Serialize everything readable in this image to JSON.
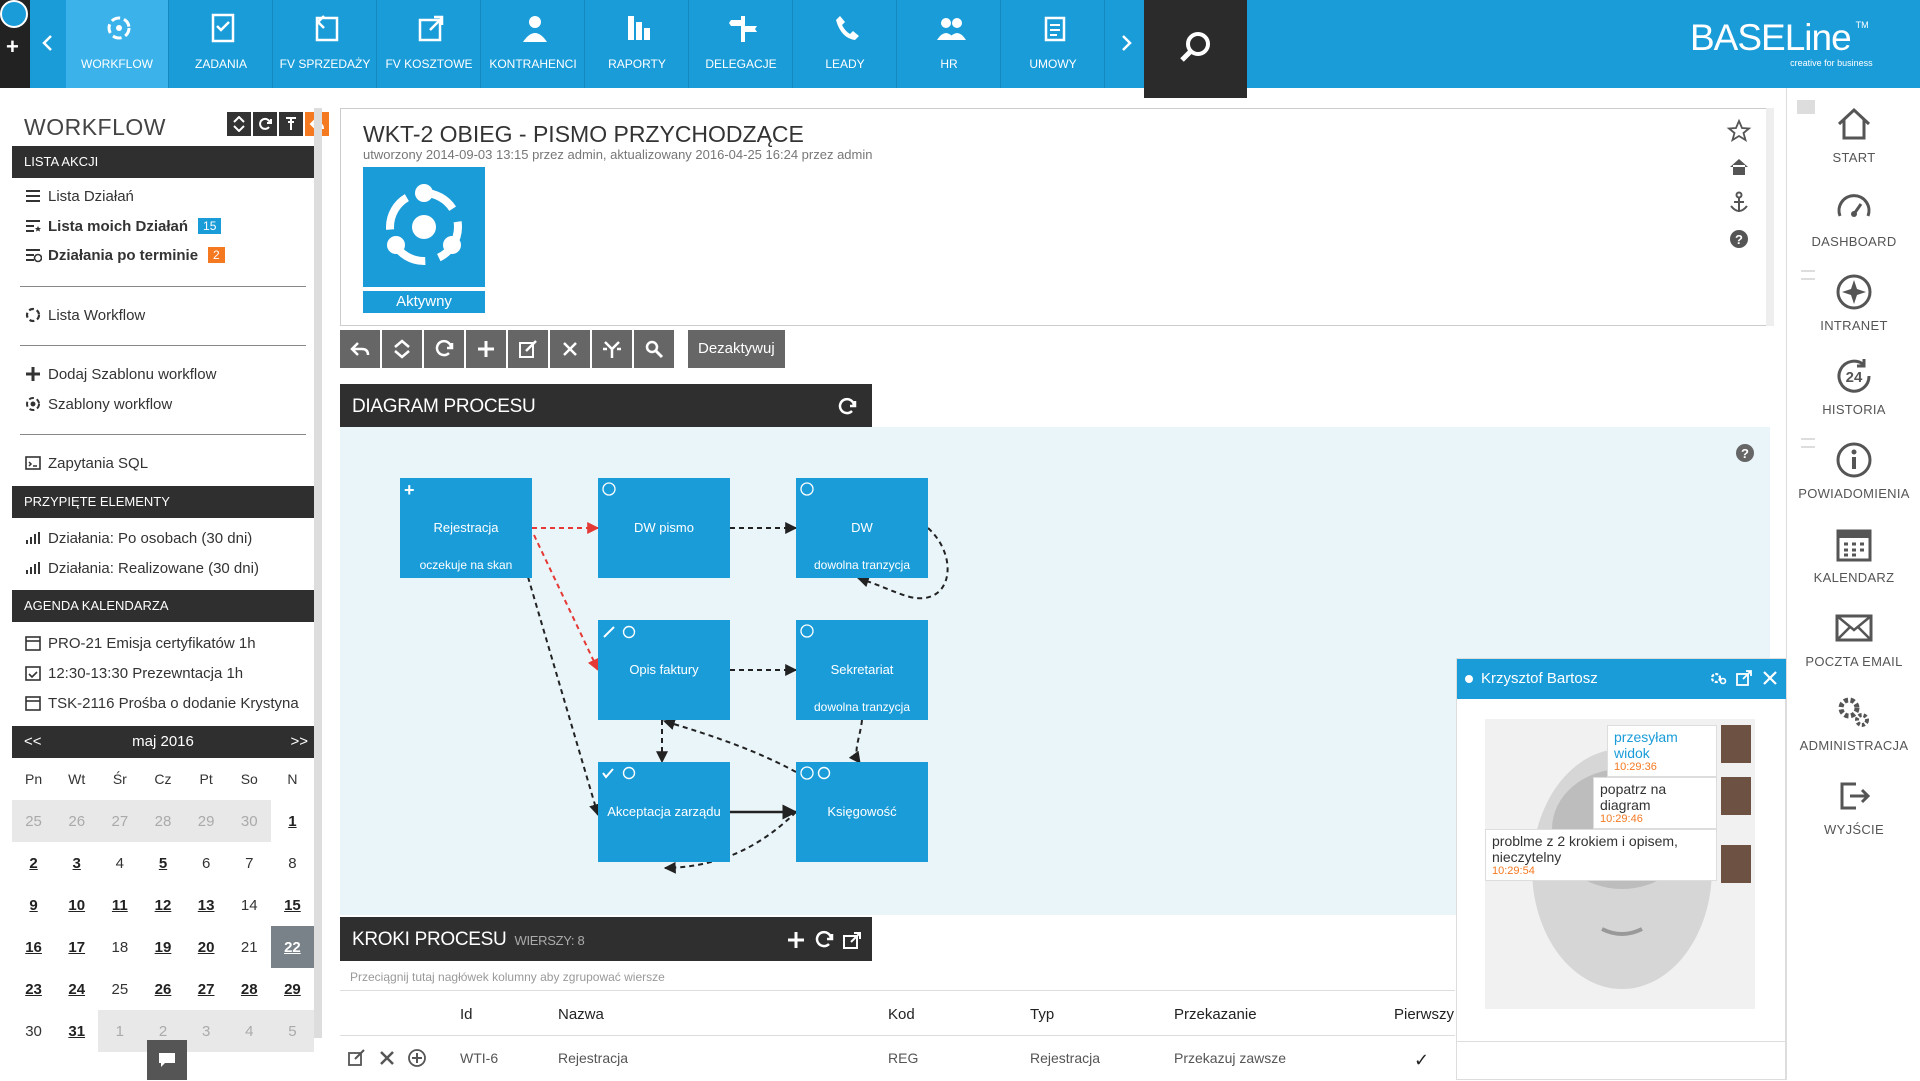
{
  "topbar": {
    "modules": [
      {
        "label": "WORKFLOW",
        "icon": "workflow-icon",
        "active": true
      },
      {
        "label": "ZADANIA",
        "icon": "tasks-icon"
      },
      {
        "label": "FV SPRZEDAŻY",
        "icon": "sales-invoice-icon"
      },
      {
        "label": "FV KOSZTOWE",
        "icon": "cost-invoice-icon"
      },
      {
        "label": "KONTRAHENCI",
        "icon": "contractors-icon"
      },
      {
        "label": "RAPORTY",
        "icon": "reports-icon"
      },
      {
        "label": "DELEGACJE",
        "icon": "signpost-icon"
      },
      {
        "label": "LEADY",
        "icon": "phone-icon"
      },
      {
        "label": "HR",
        "icon": "people-icon"
      },
      {
        "label": "UMOWY",
        "icon": "document-icon"
      }
    ],
    "brand": {
      "name": "BASELine",
      "tm": "TM",
      "tagline": "creative for business"
    }
  },
  "sidebar": {
    "title": "WORKFLOW",
    "section_actions": "LISTA AKCJI",
    "actions": [
      {
        "label": "Lista Działań"
      },
      {
        "label": "Lista moich Działań",
        "badge": "15"
      },
      {
        "label": "Działania po terminie",
        "badge": "2"
      },
      {
        "label": "Lista Workflow"
      },
      {
        "label": "Dodaj Szablonu workflow"
      },
      {
        "label": "Szablony workflow"
      },
      {
        "label": "Zapytania SQL"
      }
    ],
    "section_pinned": "PRZYPIĘTE ELEMENTY",
    "pinned": [
      {
        "label": "Działania: Po osobach (30 dni)"
      },
      {
        "label": "Działania: Realizowane (30 dni)"
      }
    ],
    "section_agenda": "AGENDA KALENDARZA",
    "agenda": [
      {
        "label": "PRO-21 Emisja certyfikatów 1h"
      },
      {
        "label": "12:30-13:30 Prezewntacja 1h"
      },
      {
        "label": "TSK-2116 Prośba o dodanie Krystyna"
      }
    ],
    "calendar": {
      "prev": "<<",
      "next": ">>",
      "month": "maj 2016",
      "days_of_week": [
        "Pn",
        "Wt",
        "Śr",
        "Cz",
        "Pt",
        "So",
        "N"
      ],
      "weeks": [
        [
          "25",
          "26",
          "27",
          "28",
          "29",
          "30",
          "1"
        ],
        [
          "2",
          "3",
          "4",
          "5",
          "6",
          "7",
          "8"
        ],
        [
          "9",
          "10",
          "11",
          "12",
          "13",
          "14",
          "15"
        ],
        [
          "16",
          "17",
          "18",
          "19",
          "20",
          "21",
          "22"
        ],
        [
          "23",
          "24",
          "25",
          "26",
          "27",
          "28",
          "29"
        ],
        [
          "30",
          "31",
          "1",
          "2",
          "3",
          "4",
          "5"
        ]
      ],
      "today": "22"
    }
  },
  "workflow": {
    "title": "WKT-2  OBIEG - PISMO PRZYCHODZĄCE",
    "meta": "utworzony 2014-09-03 13:15 przez admin, aktualizowany 2016-04-25 16:24 przez admin",
    "status": "Aktywny",
    "deactivate_label": "Dezaktywuj"
  },
  "diagram": {
    "title": "DIAGRAM PROCESU",
    "nodes": [
      {
        "title": "Rejestracja",
        "sub": "oczekuje na skan"
      },
      {
        "title": "DW pismo",
        "sub": ""
      },
      {
        "title": "DW",
        "sub": "dowolna tranzycja"
      },
      {
        "title": "Opis faktury",
        "sub": ""
      },
      {
        "title": "Sekretariat",
        "sub": "dowolna tranzycja"
      },
      {
        "title": "Akceptacja zarządu",
        "sub": ""
      },
      {
        "title": "Księgowość",
        "sub": ""
      }
    ],
    "colors": {
      "node": "#1a9cd9",
      "highlight_edge": "#e53935",
      "edge": "#222222",
      "background": "#eaf5fa"
    }
  },
  "steps": {
    "title": "KROKI PROCESU",
    "rows_label": "WIERSZY: 8",
    "group_hint": "Przeciągnij tutaj nagłówek kolumny aby zgrupować wiersze",
    "columns": [
      "Id",
      "Nazwa",
      "Kod",
      "Typ",
      "Przekazanie",
      "Pierwszy"
    ],
    "row": {
      "id": "WTI-6",
      "name": "Rejestracja",
      "code": "REG",
      "type": "Rejestracja",
      "transfer": "Przekazuj zawsze",
      "first": "✓"
    }
  },
  "chat": {
    "name": "Krzysztof Bartosz",
    "messages": [
      {
        "text": "przesyłam widok",
        "time": "10:29:36",
        "self": true
      },
      {
        "text": "popatrz na diagram",
        "time": "10:29:46",
        "self": false
      },
      {
        "text": "problme z 2 krokiem i opisem, nieczytelny",
        "time": "10:29:54",
        "self": false
      }
    ]
  },
  "right_nav": [
    {
      "label": "START",
      "icon": "home-icon"
    },
    {
      "label": "DASHBOARD",
      "icon": "gauge-icon"
    },
    {
      "label": "INTRANET",
      "icon": "compass-icon"
    },
    {
      "label": "HISTORIA",
      "icon": "history-24-icon"
    },
    {
      "label": "POWIADOMIENIA",
      "icon": "info-icon"
    },
    {
      "label": "KALENDARZ",
      "icon": "calendar-icon"
    },
    {
      "label": "POCZTA EMAIL",
      "icon": "mail-icon"
    },
    {
      "label": "ADMINISTRACJA",
      "icon": "gears-icon"
    },
    {
      "label": "WYJŚCIE",
      "icon": "exit-icon"
    }
  ]
}
